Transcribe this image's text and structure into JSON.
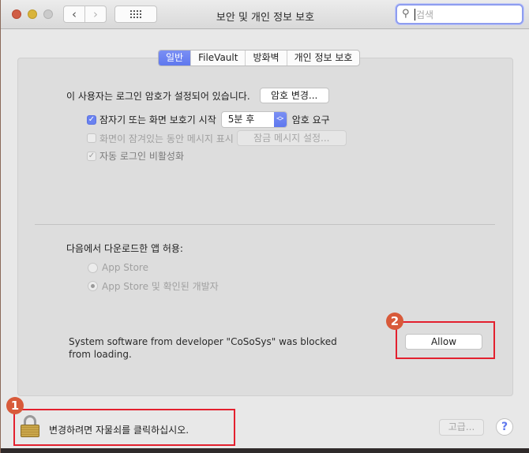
{
  "window": {
    "title": "보안 및 개인 정보 보호",
    "search_placeholder": "검색"
  },
  "tabs": [
    {
      "label": "일반",
      "active": true
    },
    {
      "label": "FileVault",
      "active": false
    },
    {
      "label": "방화벽",
      "active": false
    },
    {
      "label": "개인 정보 보호",
      "active": false
    }
  ],
  "general": {
    "password_set_text": "이 사용자는 로그인 암호가 설정되어 있습니다.",
    "change_password_button": "암호 변경...",
    "require_password": {
      "checked": true,
      "label": "잠자기 또는 화면 보호기 시작",
      "delay_value": "5분 후",
      "suffix": "암호 요구"
    },
    "show_message": {
      "checked": false,
      "label": "화면이 잠겨있는 동안 메시지 표시",
      "button": "잠금 메시지 설정..."
    },
    "disable_auto_login": {
      "checked": true,
      "label": "자동 로그인 비활성화"
    }
  },
  "downloads": {
    "heading": "다음에서 다운로드한 앱 허용:",
    "options": [
      {
        "label": "App Store",
        "selected": false
      },
      {
        "label": "App Store 및 확인된 개발자",
        "selected": true
      }
    ]
  },
  "blocked": {
    "message": "System software from developer \"CoSoSys\" was blocked from loading.",
    "allow_button": "Allow"
  },
  "footer": {
    "lock_text": "변경하려면 자물쇠를 클릭하십시오.",
    "advanced_button": "고급...",
    "help_button": "?"
  },
  "annotations": {
    "badge_1": "1",
    "badge_2": "2",
    "highlight_color": "#e3202e",
    "badge_color": "#d85a3a"
  },
  "colors": {
    "accent": "#6a82f0"
  }
}
